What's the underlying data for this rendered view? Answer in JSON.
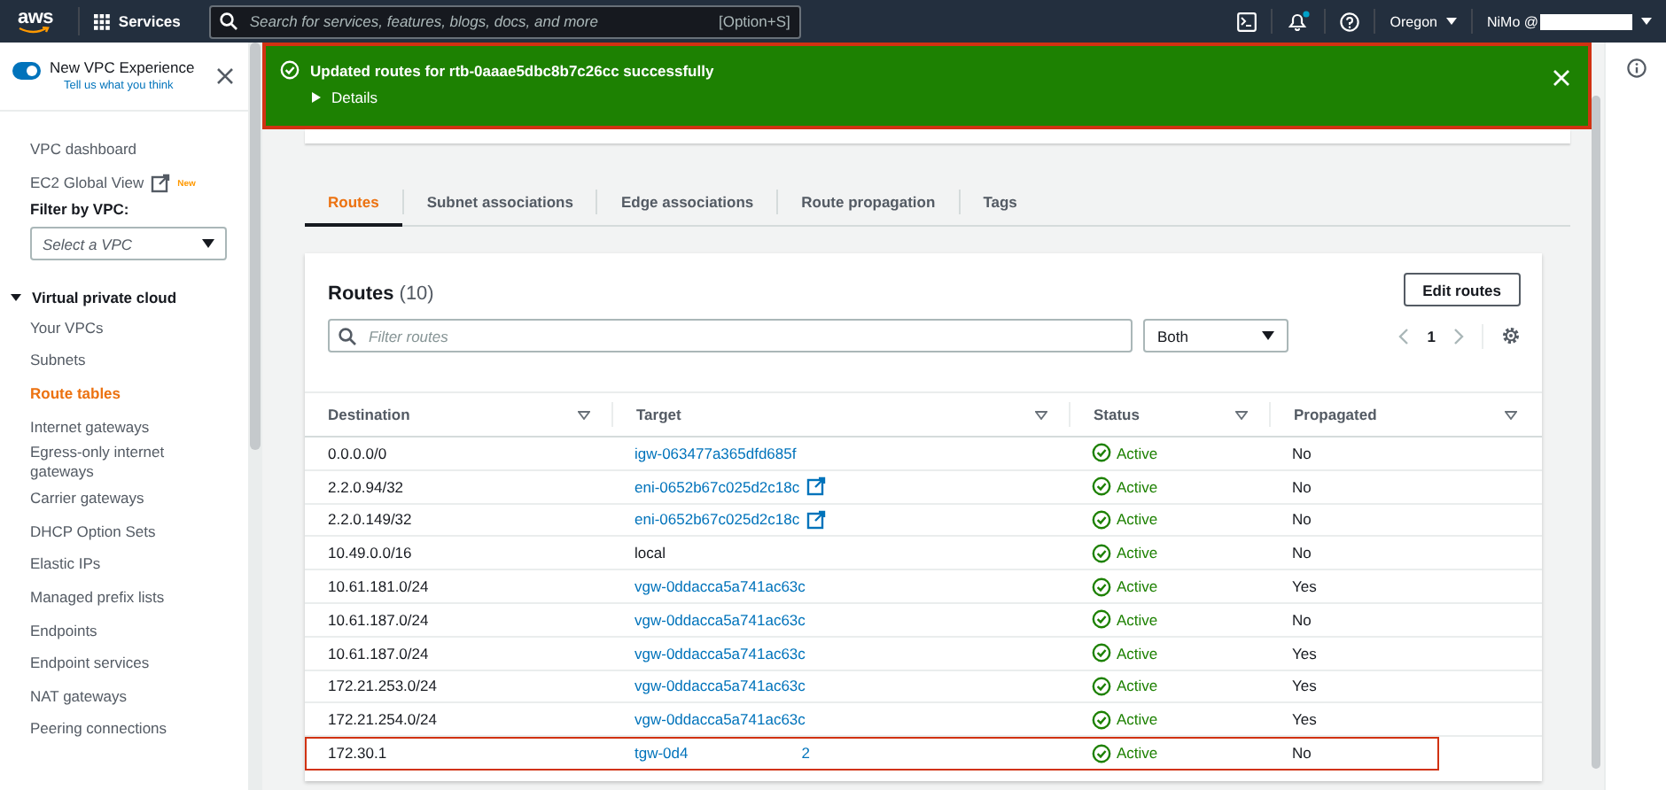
{
  "top_nav": {
    "logo": "aws",
    "services": "Services",
    "search": {
      "placeholder": "Search for services, features, blogs, docs, and more",
      "shortcut": "[Option+S]"
    },
    "notifications_unread": true,
    "region": "Oregon",
    "account": "NiMo @"
  },
  "sidebar": {
    "experience_toggle": {
      "label": "New VPC Experience",
      "on": true,
      "feedback": "Tell us what you think"
    },
    "items": [
      {
        "label": "VPC dashboard",
        "kind": "link",
        "selected": false
      },
      {
        "label": "EC2 Global View",
        "kind": "external",
        "badge": "New",
        "selected": false
      }
    ],
    "filter": {
      "label": "Filter by VPC:",
      "placeholder": "Select a VPC"
    },
    "section": {
      "label": "Virtual private cloud",
      "expanded": true,
      "items": [
        {
          "label": "Your VPCs",
          "selected": false
        },
        {
          "label": "Subnets",
          "selected": false
        },
        {
          "label": "Route tables",
          "selected": true
        },
        {
          "label": "Internet gateways",
          "selected": false
        },
        {
          "label": "Egress-only internet gateways",
          "selected": false
        },
        {
          "label": "Carrier gateways",
          "selected": false
        },
        {
          "label": "DHCP Option Sets",
          "selected": false
        },
        {
          "label": "Elastic IPs",
          "selected": false
        },
        {
          "label": "Managed prefix lists",
          "selected": false
        },
        {
          "label": "Endpoints",
          "selected": false
        },
        {
          "label": "Endpoint services",
          "selected": false
        },
        {
          "label": "NAT gateways",
          "selected": false
        },
        {
          "label": "Peering connections",
          "selected": false
        }
      ]
    }
  },
  "flash": {
    "kind": "success",
    "message": "Updated routes for rtb-0aaae5dbc8b7c26cc successfully",
    "details": "Details"
  },
  "tabs": [
    {
      "label": "Routes",
      "selected": true
    },
    {
      "label": "Subnet associations",
      "selected": false
    },
    {
      "label": "Edge associations",
      "selected": false
    },
    {
      "label": "Route propagation",
      "selected": false
    },
    {
      "label": "Tags",
      "selected": false
    }
  ],
  "routes": {
    "title": "Routes",
    "count": "(10)",
    "edit_button": "Edit routes",
    "filter_placeholder": "Filter routes",
    "filter_select": "Both",
    "page": "1",
    "columns": [
      "Destination",
      "Target",
      "Status",
      "Propagated"
    ],
    "rows": [
      {
        "destination": "0.0.0.0/0",
        "target": "igw-063477a365dfd685f",
        "kind": "link",
        "status": "Active",
        "propagated": "No",
        "highlighted": false
      },
      {
        "destination": "2.2.0.94/32",
        "target": "eni-0652b67c025d2c18c",
        "kind": "external",
        "status": "Active",
        "propagated": "No",
        "highlighted": false
      },
      {
        "destination": "2.2.0.149/32",
        "target": "eni-0652b67c025d2c18c",
        "kind": "external",
        "status": "Active",
        "propagated": "No",
        "highlighted": false
      },
      {
        "destination": "10.49.0.0/16",
        "target": "local",
        "kind": "text",
        "status": "Active",
        "propagated": "No",
        "highlighted": false
      },
      {
        "destination": "10.61.181.0/24",
        "target": "vgw-0ddacca5a741ac63c",
        "kind": "link",
        "status": "Active",
        "propagated": "Yes",
        "highlighted": false
      },
      {
        "destination": "10.61.187.0/24",
        "target": "vgw-0ddacca5a741ac63c",
        "kind": "link",
        "status": "Active",
        "propagated": "No",
        "highlighted": false
      },
      {
        "destination": "10.61.187.0/24",
        "target": "vgw-0ddacca5a741ac63c",
        "kind": "link",
        "status": "Active",
        "propagated": "Yes",
        "highlighted": false
      },
      {
        "destination": "172.21.253.0/24",
        "target": "vgw-0ddacca5a741ac63c",
        "kind": "link",
        "status": "Active",
        "propagated": "Yes",
        "highlighted": false
      },
      {
        "destination": "172.21.254.0/24",
        "target": "vgw-0ddacca5a741ac63c",
        "kind": "link",
        "status": "Active",
        "propagated": "Yes",
        "highlighted": false
      },
      {
        "destination": "172.30.1",
        "target": "tgw-0d4",
        "kind": "redacted",
        "target_end": "2",
        "status": "Active",
        "propagated": "No",
        "highlighted": true
      }
    ]
  }
}
